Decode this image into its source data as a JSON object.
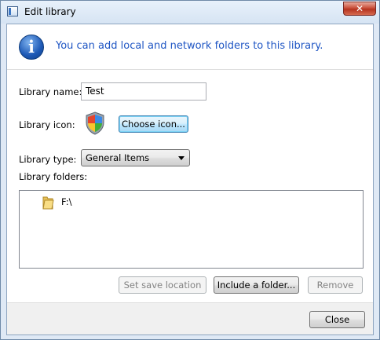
{
  "window": {
    "title": "Edit library",
    "close_glyph": "✕"
  },
  "info": {
    "icon": "information-icon",
    "icon_glyph": "i",
    "message": "You can add local and network folders to this library."
  },
  "form": {
    "name_label": "Library name:",
    "name_value": "Test",
    "icon_label": "Library icon:",
    "choose_icon_label": "Choose icon...",
    "type_label": "Library type:",
    "type_value": "General Items",
    "folders_label": "Library folders:"
  },
  "folders": [
    {
      "icon": "folder-icon",
      "name": "F:\\"
    }
  ],
  "actions": {
    "set_save_location": "Set save location",
    "include_folder": "Include a folder...",
    "remove": "Remove"
  },
  "footer": {
    "close": "Close"
  },
  "colors": {
    "info_text": "#1f56c4",
    "close_button_red": "#c9503b",
    "focus_blue": "#3c7fb1"
  }
}
